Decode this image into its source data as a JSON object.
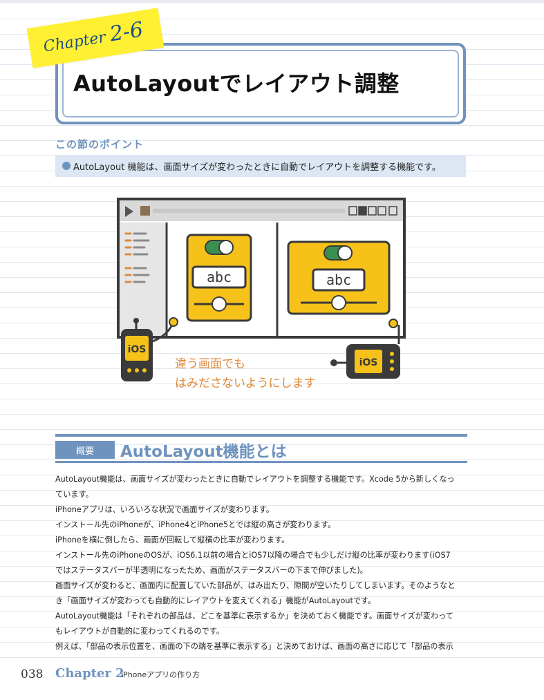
{
  "chapter": {
    "label": "Chapter",
    "number": "2-6"
  },
  "title": "AutoLayoutでレイアウト調整",
  "point": {
    "heading": "この節のポイント",
    "text": "AutoLayout 機能は、画面サイズが変わったときに自動でレイアウトを調整する機能です。"
  },
  "illustration": {
    "screen_text": "abc",
    "robot_label": "iOS",
    "caption_line1": "違う画面でも",
    "caption_line2": "はみださないようにします",
    "colors": {
      "frame": "#3a3a3a",
      "panel_yellow": "#f6c21a",
      "toggle_green": "#3a8f4e",
      "caption": "#e0893a"
    }
  },
  "section": {
    "tag": "概要",
    "title": "AutoLayout機能とは"
  },
  "body_lines": [
    "AutoLayout機能は、画面サイズが変わったときに自動でレイアウトを調整する機能です。Xcode 5から新しくなっ",
    "ています。",
    "iPhoneアプリは、いろいろな状況で画面サイズが変わります。",
    "インストール先のiPhoneが、iPhone4とiPhone5とでは縦の高さが変わります。",
    "iPhoneを横に倒したら、画面が回転して縦横の比率が変わります。",
    "インストール先のiPhoneのOSが、iOS6.1以前の場合とiOS7以降の場合でも少しだけ縦の比率が変わります(iOS7",
    "ではステータスバーが半透明になったため、画面がステータスバーの下まで伸びました)。",
    "画面サイズが変わると、画面内に配置していた部品が、はみ出たり、隙間が空いたりしてしまいます。そのようなと",
    "き「画面サイズが変わっても自動的にレイアウトを変えてくれる」機能がAutoLayoutです。",
    "AutoLayout機能は「それぞれの部品は、どこを基準に表示するか」を決めておく機能です。画面サイズが変わって",
    "もレイアウトが自動的に変わってくれるのです。",
    "例えば、「部品の表示位置を、画面の下の端を基準に表示する」と決めておけば、画面の高さに応じて「部品の表示"
  ],
  "footer": {
    "page": "038",
    "chapter": "Chapter 2",
    "subtitle": "iPhoneアプリの作り方"
  }
}
